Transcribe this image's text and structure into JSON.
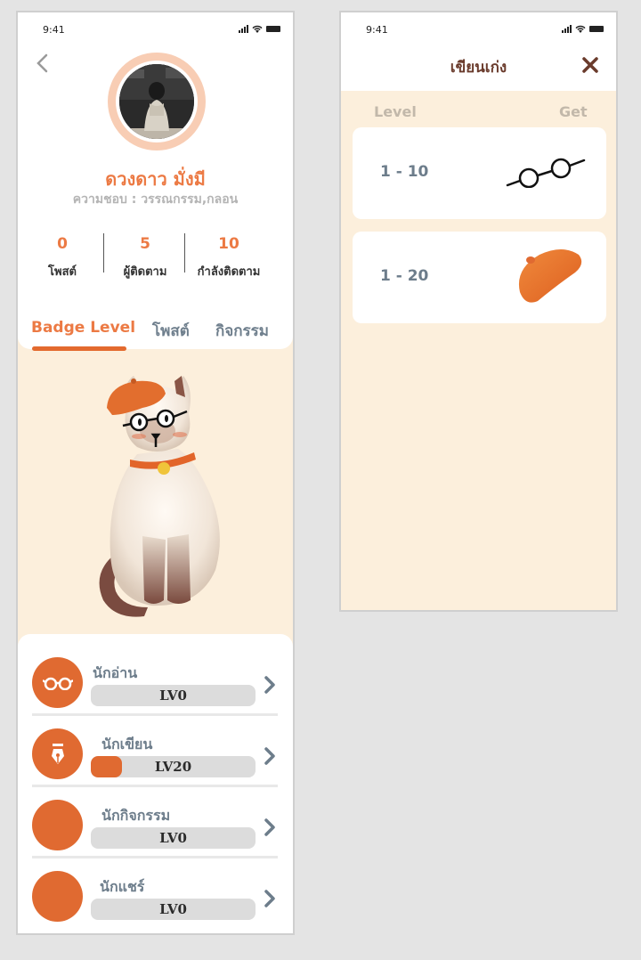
{
  "profile_screen": {
    "status_time": "9:41",
    "user": {
      "name": "ดวงดาว มั่งมี",
      "hobby": "ความชอบ : วรรณกรรม,กลอน"
    },
    "stats": [
      {
        "value": "0",
        "label": "โพสต์"
      },
      {
        "value": "5",
        "label": "ผู้ติดตาม"
      },
      {
        "value": "10",
        "label": "กำลังติดตาม"
      }
    ],
    "tabs": [
      {
        "label": "Badge Level",
        "active": true
      },
      {
        "label": "โพสต์",
        "active": false
      },
      {
        "label": "กิจกรรม",
        "active": false
      }
    ],
    "badges": [
      {
        "label": "นักอ่าน",
        "level_text": "LV0",
        "progress": 0,
        "icon": "glasses-icon"
      },
      {
        "label": "นักเขียน",
        "level_text": "LV20",
        "progress": 0.19,
        "icon": "pen-nib-icon"
      },
      {
        "label": "นักกิจกรรม",
        "level_text": "LV0",
        "progress": 0,
        "icon": ""
      },
      {
        "label": "นักแชร์",
        "level_text": "LV0",
        "progress": 0,
        "icon": ""
      }
    ]
  },
  "level_screen": {
    "status_time": "9:41",
    "title": "เขียนเก่ง",
    "close_label": "X",
    "col_level": "Level",
    "col_get": "Get",
    "rows": [
      {
        "range": "1 - 10",
        "reward_icon": "glasses-icon"
      },
      {
        "range": "1 - 20",
        "reward_icon": "beret-icon"
      }
    ]
  },
  "colors": {
    "accent": "#ec7a44",
    "badge_orange": "#e06a31",
    "background_cream": "#fcefdc",
    "title_brown": "#6a3b2c",
    "label_gray": "#6d7d8b"
  }
}
